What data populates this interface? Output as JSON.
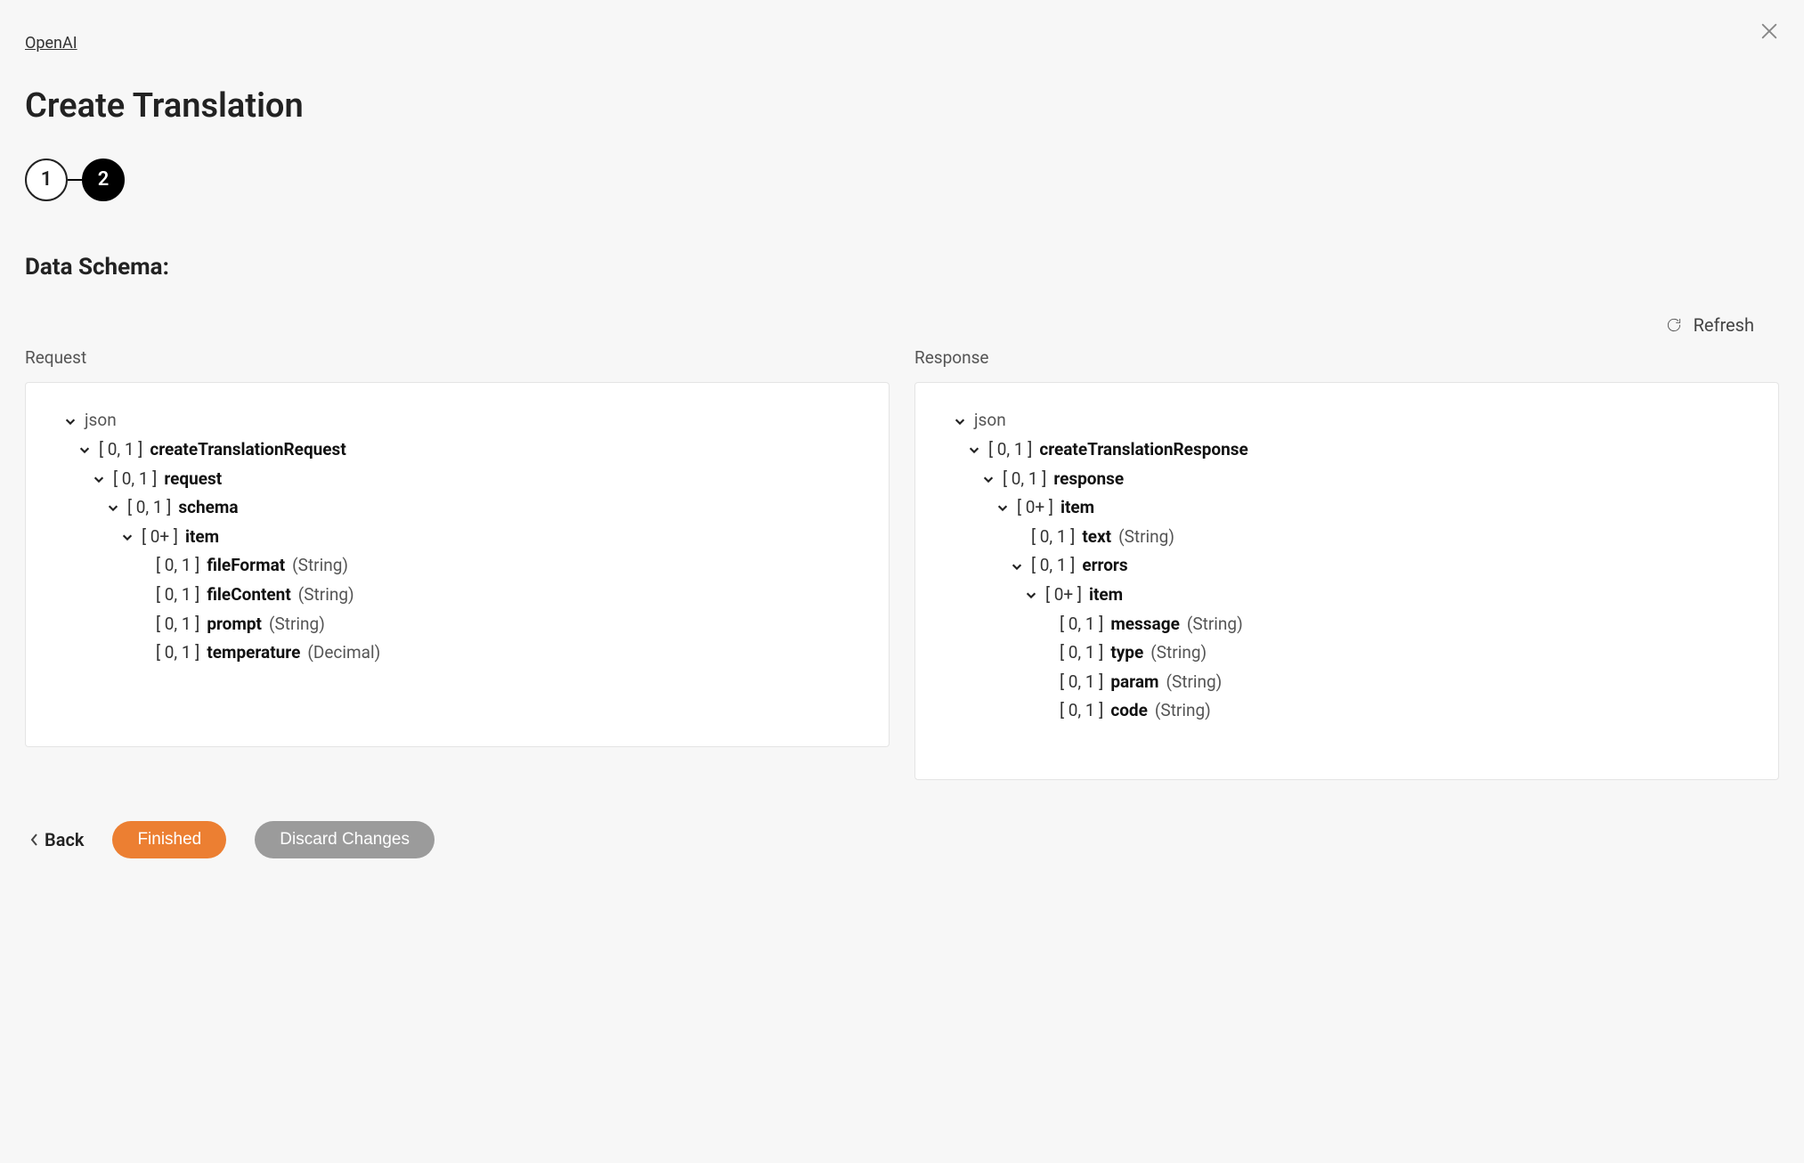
{
  "breadcrumb": "OpenAI",
  "title": "Create Translation",
  "steps": [
    "1",
    "2"
  ],
  "active_step_index": 1,
  "section_heading": "Data Schema:",
  "refresh_label": "Refresh",
  "columns": {
    "request_label": "Request",
    "response_label": "Response"
  },
  "request_tree": [
    {
      "indent": 0,
      "chev": true,
      "card": "",
      "name": "json",
      "name_class": "root-name",
      "type": ""
    },
    {
      "indent": 1,
      "chev": true,
      "card": "[ 0, 1 ]",
      "name": "createTranslationRequest",
      "type": ""
    },
    {
      "indent": 2,
      "chev": true,
      "card": "[ 0, 1 ]",
      "name": "request",
      "type": ""
    },
    {
      "indent": 3,
      "chev": true,
      "card": "[ 0, 1 ]",
      "name": "schema",
      "type": ""
    },
    {
      "indent": 4,
      "chev": true,
      "card": "[ 0+ ]",
      "name": "item",
      "type": ""
    },
    {
      "indent": 5,
      "chev": false,
      "card": "[ 0, 1 ]",
      "name": "fileFormat",
      "type": "(String)"
    },
    {
      "indent": 5,
      "chev": false,
      "card": "[ 0, 1 ]",
      "name": "fileContent",
      "type": "(String)"
    },
    {
      "indent": 5,
      "chev": false,
      "card": "[ 0, 1 ]",
      "name": "prompt",
      "type": "(String)"
    },
    {
      "indent": 5,
      "chev": false,
      "card": "[ 0, 1 ]",
      "name": "temperature",
      "type": "(Decimal)"
    }
  ],
  "response_tree": [
    {
      "indent": 0,
      "chev": true,
      "card": "",
      "name": "json",
      "name_class": "root-name",
      "type": ""
    },
    {
      "indent": 1,
      "chev": true,
      "card": "[ 0, 1 ]",
      "name": "createTranslationResponse",
      "type": ""
    },
    {
      "indent": 2,
      "chev": true,
      "card": "[ 0, 1 ]",
      "name": "response",
      "type": ""
    },
    {
      "indent": 3,
      "chev": true,
      "card": "[ 0+ ]",
      "name": "item",
      "type": ""
    },
    {
      "indent": 4,
      "chev": false,
      "card": "[ 0, 1 ]",
      "name": "text",
      "type": "(String)"
    },
    {
      "indent": 4,
      "chev": true,
      "card": "[ 0, 1 ]",
      "name": "errors",
      "type": ""
    },
    {
      "indent": 5,
      "chev": true,
      "card": "[ 0+ ]",
      "name": "item",
      "type": ""
    },
    {
      "indent": 6,
      "chev": false,
      "card": "[ 0, 1 ]",
      "name": "message",
      "type": "(String)"
    },
    {
      "indent": 6,
      "chev": false,
      "card": "[ 0, 1 ]",
      "name": "type",
      "type": "(String)"
    },
    {
      "indent": 6,
      "chev": false,
      "card": "[ 0, 1 ]",
      "name": "param",
      "type": "(String)"
    },
    {
      "indent": 6,
      "chev": false,
      "card": "[ 0, 1 ]",
      "name": "code",
      "type": "(String)"
    }
  ],
  "footer": {
    "back_label": "Back",
    "primary_label": "Finished",
    "secondary_label": "Discard Changes"
  }
}
